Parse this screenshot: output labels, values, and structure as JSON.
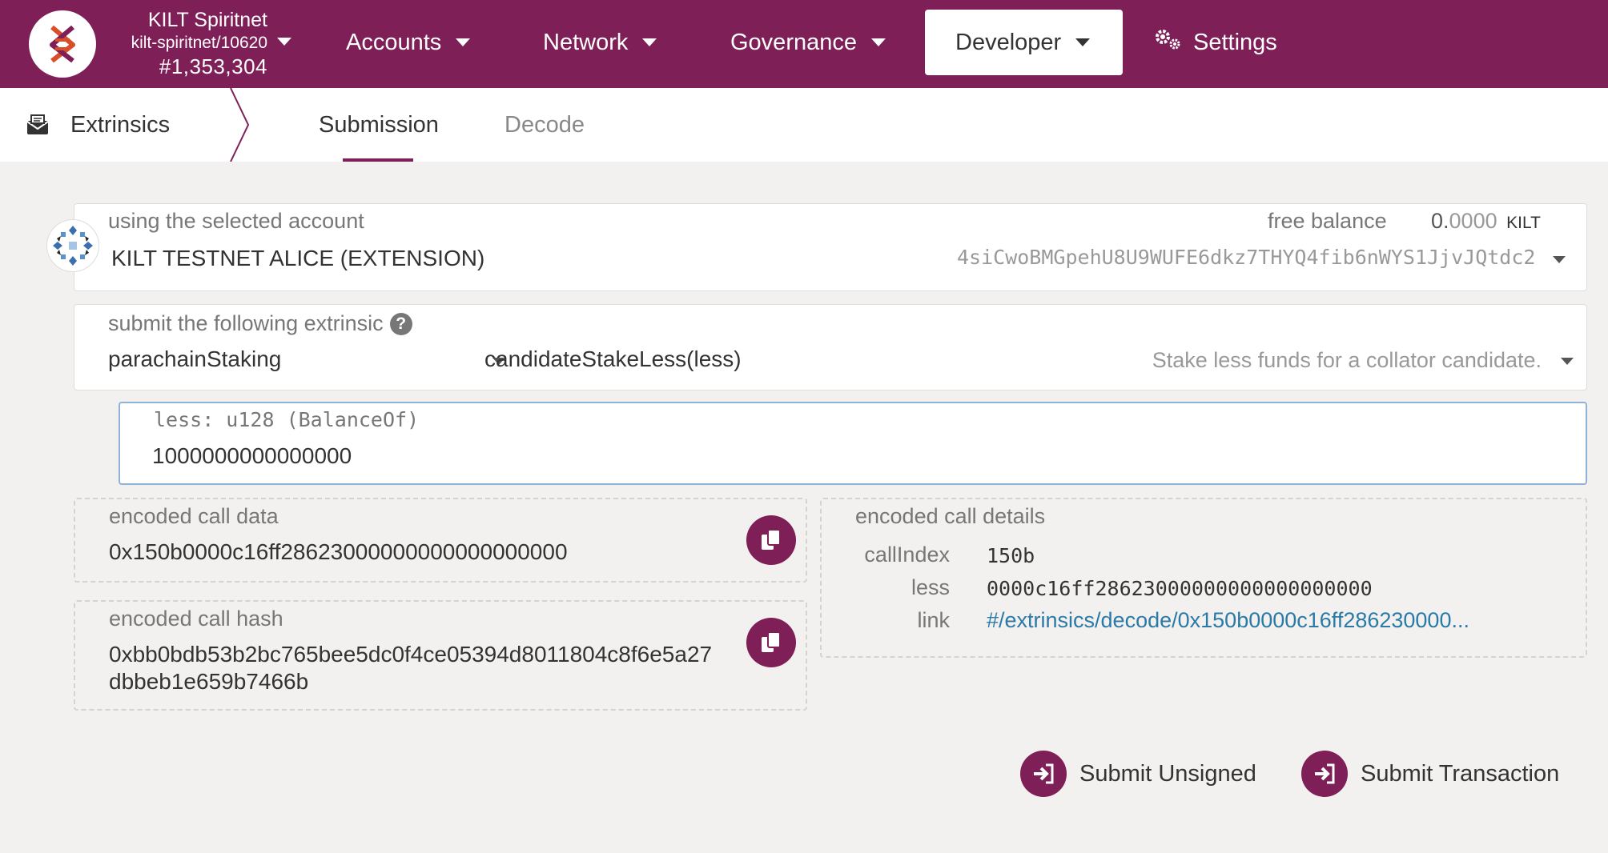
{
  "header": {
    "chain_name": "KILT Spiritnet",
    "chain_id": "kilt-spiritnet/10620",
    "block_number": "#1,353,304",
    "nav": [
      {
        "label": "Accounts"
      },
      {
        "label": "Network"
      },
      {
        "label": "Governance"
      },
      {
        "label": "Developer",
        "active": true
      },
      {
        "label": "Settings"
      }
    ]
  },
  "subnav": {
    "section": "Extrinsics",
    "tabs": [
      {
        "label": "Submission",
        "active": true
      },
      {
        "label": "Decode",
        "active": false
      }
    ]
  },
  "account": {
    "label": "using the selected account",
    "name": "KILT TESTNET ALICE (EXTENSION)",
    "balance_label": "free balance",
    "balance_int": "0.",
    "balance_dec": "0000",
    "balance_unit": "KILT",
    "address": "4siCwoBMGpehU8U9WUFE6dkz7THYQ4fib6nWYS1JjvJQtdc2"
  },
  "extrinsic": {
    "label": "submit the following extrinsic",
    "pallet": "parachainStaking",
    "call": "candidateStakeLess(less)",
    "description": "Stake less funds for a collator candidate."
  },
  "param": {
    "label": "less: u128 (BalanceOf)",
    "value": "1000000000000000"
  },
  "encoded_call_data": {
    "label": "encoded call data",
    "value": "0x150b0000c16ff28623000000000000000000"
  },
  "encoded_call_hash": {
    "label": "encoded call hash",
    "line1": "0xbb0bdb53b2bc765bee5dc0f4ce05394d8011804c8f6e5a27",
    "line2": "dbbeb1e659b7466b"
  },
  "call_details": {
    "label": "encoded call details",
    "callindex_label": "callIndex",
    "callindex_value": "150b",
    "less_label": "less",
    "less_value": "0000c16ff28623000000000000000000",
    "link_label": "link",
    "link_value": "#/extrinsics/decode/0x150b0000c16ff286230000..."
  },
  "actions": {
    "submit_unsigned": "Submit Unsigned",
    "submit_transaction": "Submit Transaction"
  },
  "colors": {
    "brand": "#7e1f57",
    "link": "#2a7aa8",
    "focus_border": "#8fb3d8"
  }
}
